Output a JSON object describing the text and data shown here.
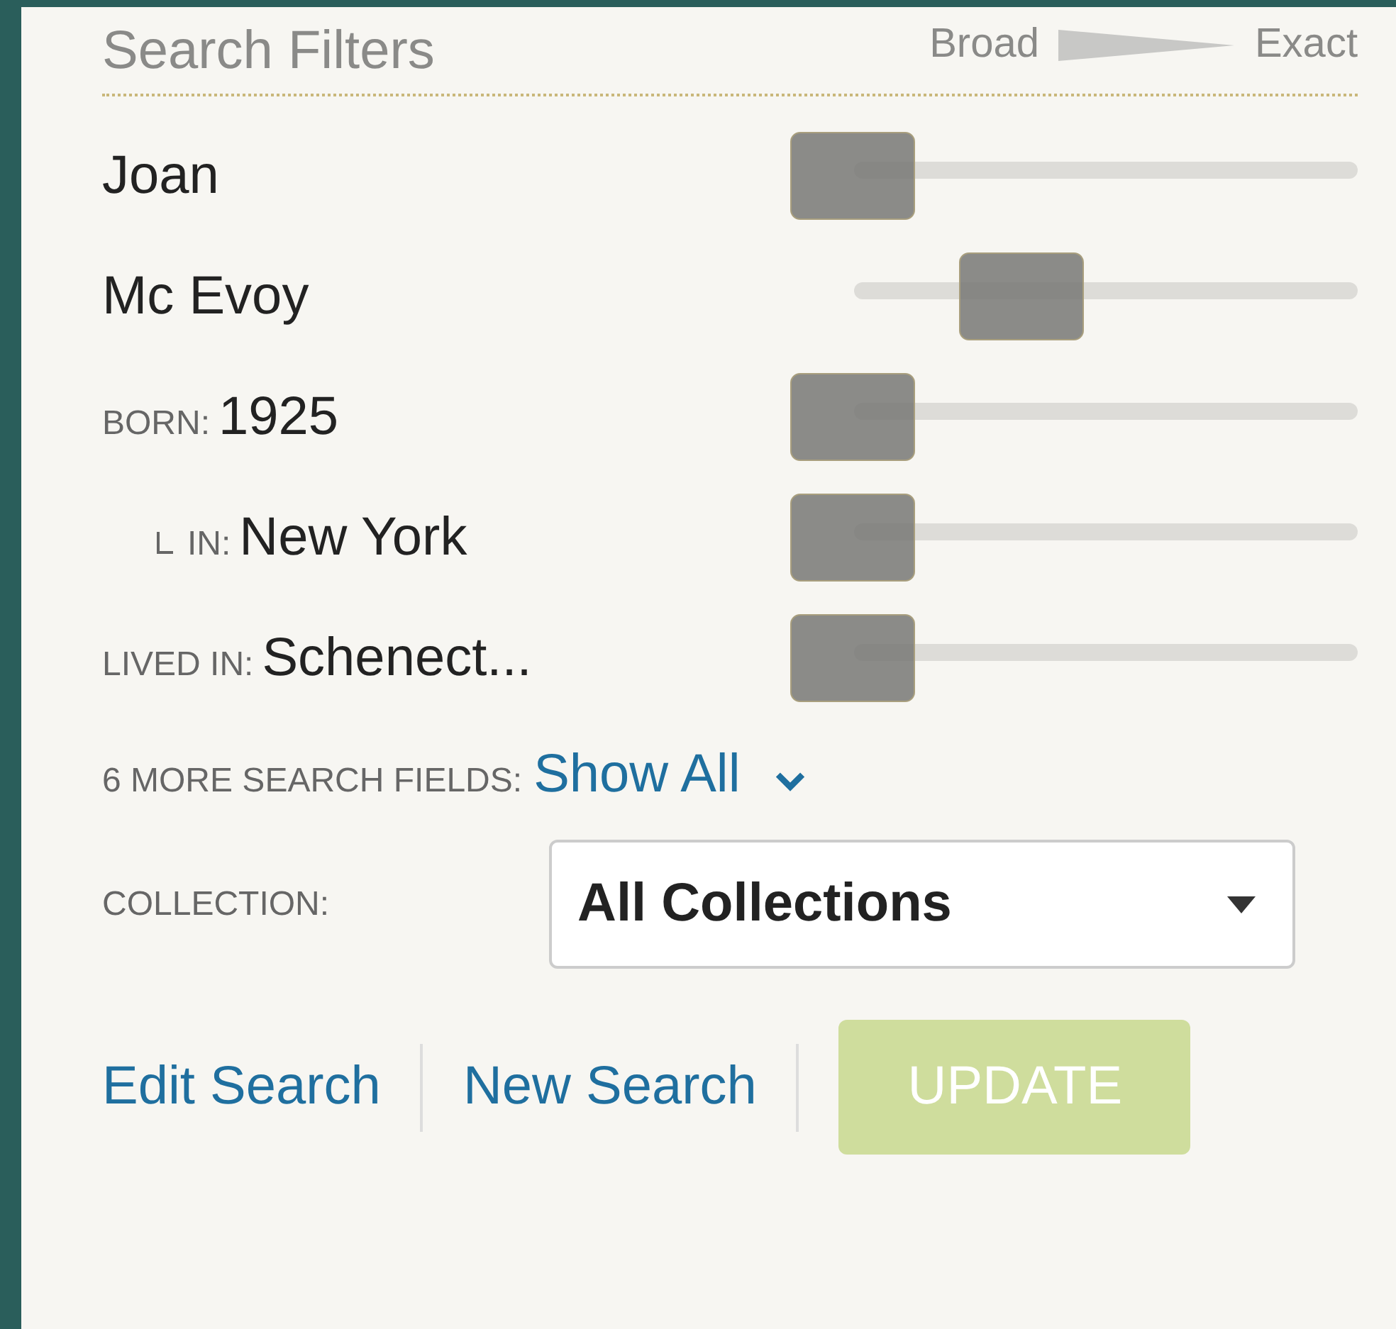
{
  "header": {
    "title": "Search Filters",
    "scale_left": "Broad",
    "scale_right": "Exact"
  },
  "filters": [
    {
      "kind": "name",
      "value": "Joan",
      "level": 0
    },
    {
      "kind": "name",
      "value": "Mc Evoy",
      "level": 0.38
    },
    {
      "kind": "field",
      "label": "BORN:",
      "value": "1925",
      "level": 0
    },
    {
      "kind": "subfield",
      "label": "IN:",
      "value": "New York",
      "level": 0
    },
    {
      "kind": "field",
      "label": "LIVED IN:",
      "value": "Schenect...",
      "level": 0
    }
  ],
  "more": {
    "label": "6 MORE SEARCH FIELDS:",
    "link": "Show All",
    "expanded": false
  },
  "collection": {
    "label": "COLLECTION:",
    "value": "All Collections"
  },
  "actions": [
    "Edit Search",
    "New Search"
  ],
  "update": {
    "label": "UPDATE",
    "disabled": true
  }
}
